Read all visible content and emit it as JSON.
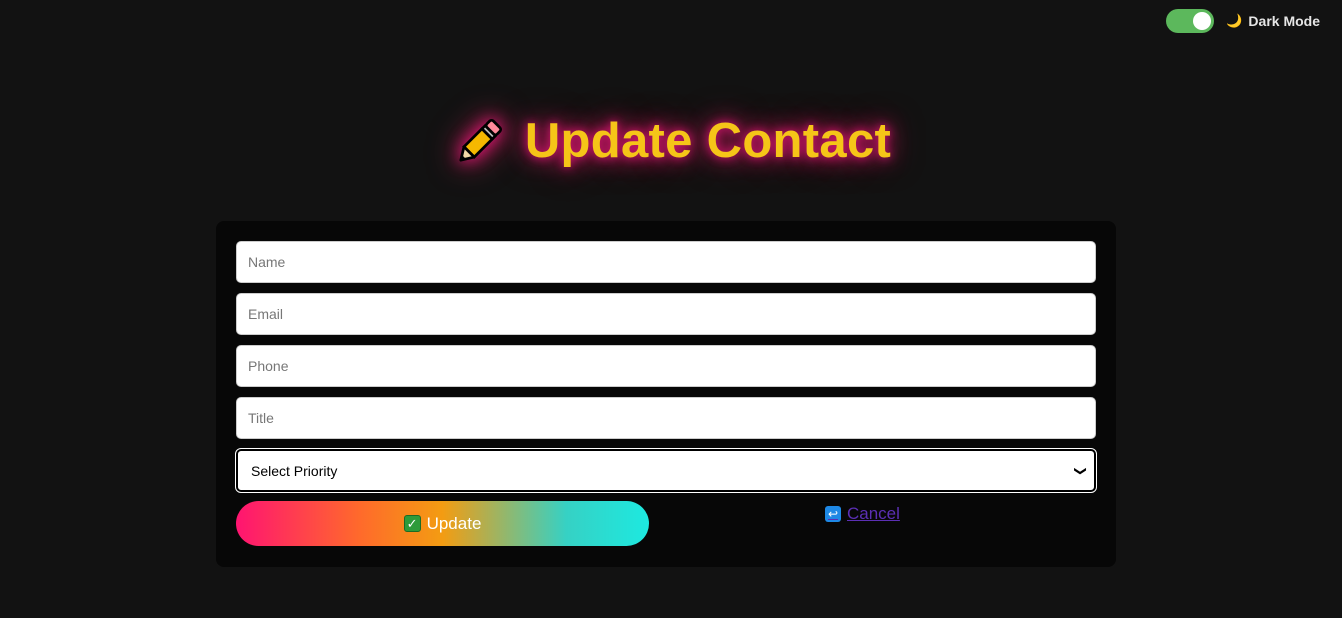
{
  "theme_toggle": {
    "label": "Dark Mode",
    "on": true,
    "moon_icon": "🌙"
  },
  "header": {
    "title": "Update Contact",
    "icon": "pencil-icon"
  },
  "form": {
    "name_placeholder": "Name",
    "email_placeholder": "Email",
    "phone_placeholder": "Phone",
    "title_placeholder": "Title",
    "priority_selected": "Select Priority"
  },
  "actions": {
    "update_label": "Update",
    "update_icon": "✓",
    "cancel_label": "Cancel",
    "cancel_icon": "↩"
  },
  "colors": {
    "background": "#121212",
    "card": "#070707",
    "title": "#f5c518",
    "glow": "#e6157a",
    "toggle": "#5cb85c",
    "cancel_link": "#5b2fb4"
  }
}
